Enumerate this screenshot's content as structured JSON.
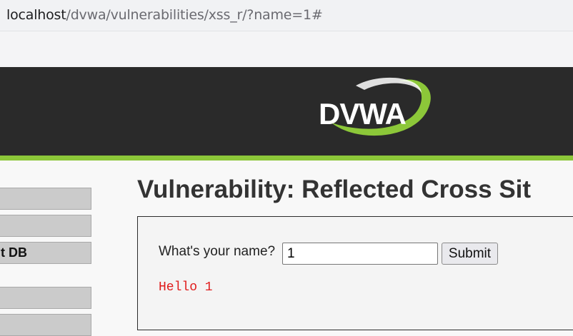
{
  "browser": {
    "url_host": "localhost",
    "url_path": "/dvwa/vulnerabilities/xss_r/?name=1#"
  },
  "header": {
    "logo_text": "DVWA",
    "logo_color": "#ffffff",
    "swoosh_color": "#8cc739",
    "background": "#2a2a2a",
    "accent_rule": "#8cc739"
  },
  "sidebar": {
    "items": [
      {
        "label": ""
      },
      {
        "label": ""
      },
      {
        "label": "SQL Injection (Blind) DB",
        "visible_label": "t DB"
      },
      {
        "label": ""
      },
      {
        "label": ""
      }
    ]
  },
  "main": {
    "title": "Vulnerability: Reflected Cross Sit",
    "form": {
      "label": "What's your name?",
      "input_value": "1",
      "submit_label": "Submit"
    },
    "result": "Hello 1",
    "result_color": "#e01b1b"
  }
}
